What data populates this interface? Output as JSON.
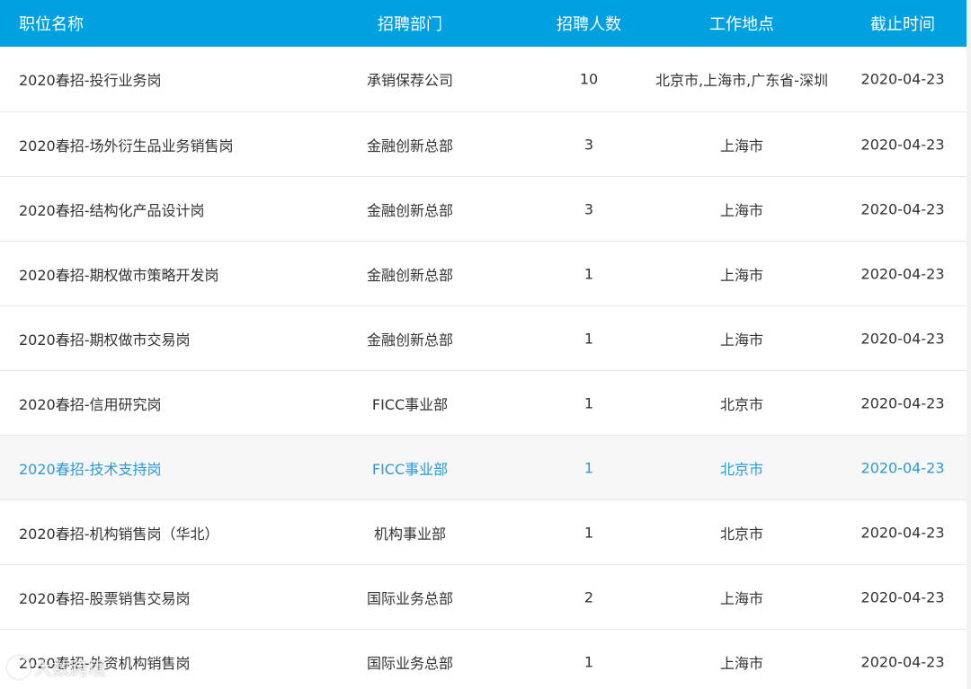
{
  "columns": {
    "name": "职位名称",
    "dept": "招聘部门",
    "count": "招聘人数",
    "location": "工作地点",
    "deadline": "截止时间"
  },
  "rows": [
    {
      "name": "2020春招-投行业务岗",
      "dept": "承销保荐公司",
      "count": "10",
      "location": "北京市,上海市,广东省-深圳",
      "deadline": "2020-04-23"
    },
    {
      "name": "2020春招-场外衍生品业务销售岗",
      "dept": "金融创新总部",
      "count": "3",
      "location": "上海市",
      "deadline": "2020-04-23"
    },
    {
      "name": "2020春招-结构化产品设计岗",
      "dept": "金融创新总部",
      "count": "3",
      "location": "上海市",
      "deadline": "2020-04-23"
    },
    {
      "name": "2020春招-期权做市策略开发岗",
      "dept": "金融创新总部",
      "count": "1",
      "location": "上海市",
      "deadline": "2020-04-23"
    },
    {
      "name": "2020春招-期权做市交易岗",
      "dept": "金融创新总部",
      "count": "1",
      "location": "上海市",
      "deadline": "2020-04-23"
    },
    {
      "name": "2020春招-信用研究岗",
      "dept": "FICC事业部",
      "count": "1",
      "location": "北京市",
      "deadline": "2020-04-23"
    },
    {
      "name": "2020春招-技术支持岗",
      "dept": "FICC事业部",
      "count": "1",
      "location": "北京市",
      "deadline": "2020-04-23"
    },
    {
      "name": "2020春招-机构销售岗（华北）",
      "dept": "机构事业部",
      "count": "1",
      "location": "北京市",
      "deadline": "2020-04-23"
    },
    {
      "name": "2020春招-股票销售交易岗",
      "dept": "国际业务总部",
      "count": "2",
      "location": "上海市",
      "deadline": "2020-04-23"
    },
    {
      "name": "2020春招-外资机构销售岗",
      "dept": "国际业务总部",
      "count": "1",
      "location": "上海市",
      "deadline": "2020-04-23"
    }
  ],
  "active_row_index": 6,
  "watermark": {
    "text": "大数跨境",
    "icon": "brand-logo-icon"
  },
  "colors": {
    "header_bg": "#00a0e1",
    "active_text": "#2a9bd6"
  }
}
